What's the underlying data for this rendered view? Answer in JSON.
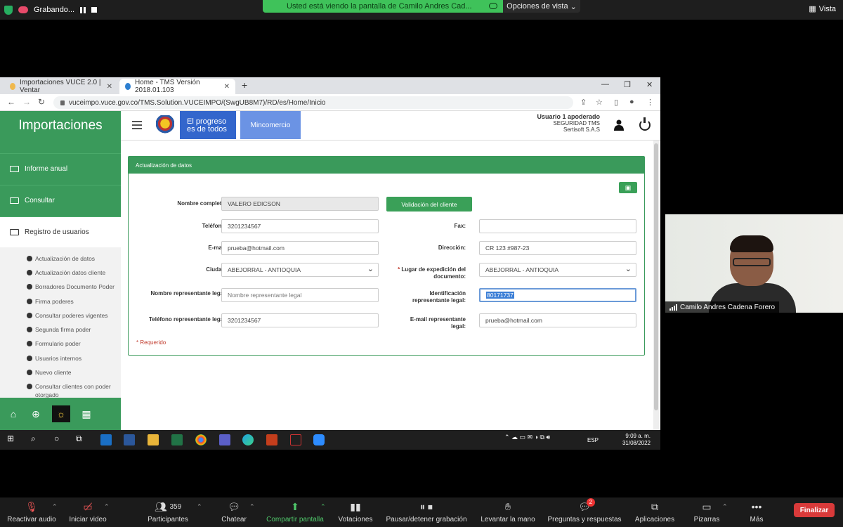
{
  "zoom_top": {
    "recording_label": "Grabando...",
    "share_banner": "Usted está viendo la pantalla de Camilo Andres Cad...",
    "view_options": "Opciones de vista",
    "vista": "Vista"
  },
  "browser": {
    "tabs": [
      {
        "title": "Importaciones VUCE 2.0 | Ventar",
        "active": false
      },
      {
        "title": "Home - TMS Versión 2018.01.103",
        "active": true
      }
    ],
    "url": "vuceimpo.vuce.gov.co/TMS.Solution.VUCEIMPO/(SwgUB8M7)/RD/es/Home/Inicio"
  },
  "app": {
    "brand": "Importaciones",
    "nav": {
      "progreso": "El progreso es de todos",
      "mincomercio": "Mincomercio",
      "user_name": "Usuario 1 apoderado",
      "user_role": "SEGURIDAD TMS",
      "user_company": "Sertisoft S.A.S"
    },
    "sidebar": {
      "items": [
        {
          "label": "Informe anual"
        },
        {
          "label": "Consultar"
        },
        {
          "label": "Registro de usuarios"
        }
      ],
      "submenu": [
        "Actualización de datos",
        "Actualización datos cliente",
        "Borradores Documento Poder",
        "Firma poderes",
        "Consultar poderes vigentes",
        "Segunda firma poder",
        "Formulario poder",
        "Usuarios internos",
        "Nuevo cliente",
        "Consultar clientes con poder otorgado"
      ]
    },
    "form": {
      "panel_title": "Actualización de datos",
      "validate_button": "Validación del cliente",
      "required_note": "* Requerido",
      "fields": {
        "nombre_label": "Nombre completo:",
        "nombre_value": "VALERO  EDICSON",
        "telefono_label": "Teléfono:",
        "telefono_value": "3201234567",
        "fax_label": "Fax:",
        "fax_value": "",
        "email_label": "E-mail:",
        "email_value": "prueba@hotmail.com",
        "direccion_label": "Dirección:",
        "direccion_value": "CR 123 #987-23",
        "ciudad_label": "Ciudad:",
        "ciudad_value": "ABEJORRAL - ANTIOQUIA",
        "lugar_label": "Lugar de expedición del documento:",
        "lugar_value": "ABEJORRAL - ANTIOQUIA",
        "rep_nombre_label": "Nombre representante legal:",
        "rep_nombre_placeholder": "Nombre representante legal",
        "rep_id_label": "Identificación representante legal:",
        "rep_id_value": "80171737",
        "rep_tel_label": "Teléfono representante legal:",
        "rep_tel_value": "3201234567",
        "rep_email_label": "E-mail representante legal:",
        "rep_email_value": "prueba@hotmail.com"
      }
    }
  },
  "taskbar": {
    "time": "9:09 a. m.",
    "date": "31/08/2022",
    "lang": "ESP"
  },
  "video": {
    "participant_name": "Camilo Andres Cadena Forero"
  },
  "zoom_bottom": {
    "buttons": [
      {
        "label": "Reactivar audio"
      },
      {
        "label": "Iniciar video"
      },
      {
        "label": "Participantes",
        "count": "359"
      },
      {
        "label": "Chatear"
      },
      {
        "label": "Compartir pantalla"
      },
      {
        "label": "Votaciones"
      },
      {
        "label": "Pausar/detener grabación"
      },
      {
        "label": "Levantar la mano"
      },
      {
        "label": "Preguntas y respuestas",
        "badge": "2"
      },
      {
        "label": "Aplicaciones"
      },
      {
        "label": "Pizarras"
      },
      {
        "label": "Más"
      }
    ],
    "end_button": "Finalizar"
  }
}
